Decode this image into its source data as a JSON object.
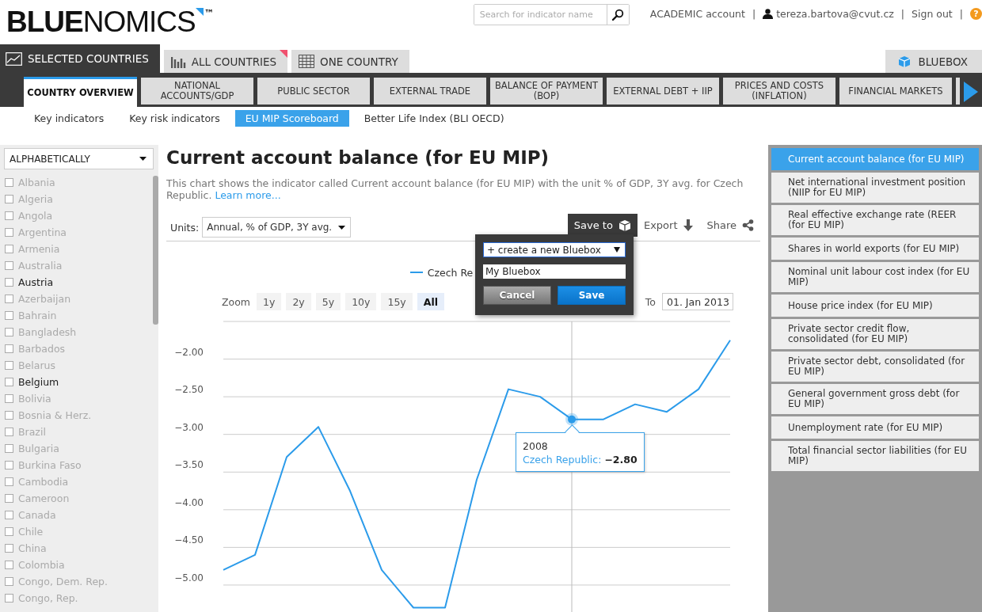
{
  "header": {
    "logo": "**BLUE**NOMICS",
    "trademark": "™",
    "search": {
      "placeholder": "Search for indicator name"
    },
    "account": "ACADEMIC account",
    "user": "tereza.bartova@cvut.cz",
    "sign_out": "Sign out",
    "separators": [
      "|",
      "|",
      "|"
    ],
    "help": "?"
  },
  "top_tabs": [
    {
      "label": "SELECTED COUNTRIES",
      "selected": true,
      "kind": "line",
      "badge": false
    },
    {
      "label": "ALL COUNTRIES",
      "selected": false,
      "kind": "bars",
      "badge": true
    },
    {
      "label": "ONE COUNTRY",
      "selected": false,
      "kind": "grid",
      "badge": false
    }
  ],
  "bluebox_button": "BLUEBOX",
  "category_tabs": [
    {
      "label": "COUNTRY OVERVIEW",
      "selected": true
    },
    {
      "label": "NATIONAL ACCOUNTS/GDP",
      "selected": false
    },
    {
      "label": "PUBLIC SECTOR",
      "selected": false
    },
    {
      "label": "EXTERNAL TRADE",
      "selected": false
    },
    {
      "label": "BALANCE OF PAYMENT (BOP)",
      "selected": false
    },
    {
      "label": "EXTERNAL DEBT + IIP",
      "selected": false
    },
    {
      "label": "PRICES AND COSTS (INFLATION)",
      "selected": false
    },
    {
      "label": "FINANCIAL MARKETS",
      "selected": false
    }
  ],
  "sub_tabs": [
    {
      "label": "Key indicators",
      "selected": false
    },
    {
      "label": "Key risk indicators",
      "selected": false
    },
    {
      "label": "EU MIP Scoreboard",
      "selected": true
    },
    {
      "label": "Better Life Index (BLI OECD)",
      "selected": false
    }
  ],
  "sidebar": {
    "sort": "ALPHABETICALLY",
    "countries": [
      {
        "name": "Albania",
        "disabled": true,
        "checked": false
      },
      {
        "name": "Algeria",
        "disabled": true,
        "checked": false
      },
      {
        "name": "Angola",
        "disabled": true,
        "checked": false
      },
      {
        "name": "Argentina",
        "disabled": true,
        "checked": false
      },
      {
        "name": "Armenia",
        "disabled": true,
        "checked": false
      },
      {
        "name": "Australia",
        "disabled": true,
        "checked": false
      },
      {
        "name": "Austria",
        "disabled": false,
        "checked": false
      },
      {
        "name": "Azerbaijan",
        "disabled": true,
        "checked": false
      },
      {
        "name": "Bahrain",
        "disabled": true,
        "checked": false
      },
      {
        "name": "Bangladesh",
        "disabled": true,
        "checked": false
      },
      {
        "name": "Barbados",
        "disabled": true,
        "checked": false
      },
      {
        "name": "Belarus",
        "disabled": true,
        "checked": false
      },
      {
        "name": "Belgium",
        "disabled": false,
        "checked": false
      },
      {
        "name": "Bolivia",
        "disabled": true,
        "checked": false
      },
      {
        "name": "Bosnia & Herz.",
        "disabled": true,
        "checked": false
      },
      {
        "name": "Brazil",
        "disabled": true,
        "checked": false
      },
      {
        "name": "Bulgaria",
        "disabled": true,
        "checked": false
      },
      {
        "name": "Burkina Faso",
        "disabled": true,
        "checked": false
      },
      {
        "name": "Cambodia",
        "disabled": true,
        "checked": false
      },
      {
        "name": "Cameroon",
        "disabled": true,
        "checked": false
      },
      {
        "name": "Canada",
        "disabled": true,
        "checked": false
      },
      {
        "name": "Chile",
        "disabled": true,
        "checked": false
      },
      {
        "name": "China",
        "disabled": true,
        "checked": false
      },
      {
        "name": "Colombia",
        "disabled": true,
        "checked": false
      },
      {
        "name": "Congo, Dem. Rep.",
        "disabled": true,
        "checked": false
      },
      {
        "name": "Congo, Rep.",
        "disabled": true,
        "checked": false
      }
    ]
  },
  "main": {
    "title": "Current account balance (for EU MIP)",
    "description": "This chart shows the indicator called Current account balance (for EU MIP) with the unit % of GDP, 3Y avg. for Czech Republic.",
    "learn_more": "Learn more...",
    "units_label": "Units:",
    "units_value": "Annual, % of GDP, 3Y avg.",
    "actions": [
      {
        "kind": "save",
        "label": "Save to",
        "selected": true
      },
      {
        "kind": "export",
        "label": "Export",
        "selected": false
      },
      {
        "kind": "share",
        "label": "Share",
        "selected": false
      }
    ],
    "legend": "Czech Re",
    "zoom_label": "Zoom",
    "zoom_buttons": [
      {
        "label": "1y",
        "selected": false
      },
      {
        "label": "2y",
        "selected": false
      },
      {
        "label": "5y",
        "selected": false
      },
      {
        "label": "10y",
        "selected": false
      },
      {
        "label": "15y",
        "selected": false
      },
      {
        "label": "All",
        "selected": true
      }
    ],
    "to_label": "To",
    "to_date": "01. Jan 2013",
    "chart_data": {
      "type": "line",
      "grid": true,
      "series": [
        {
          "color": "#2b9bea",
          "values": [
            -4.8,
            -4.6,
            -3.3,
            -2.9,
            -3.75,
            -4.8,
            -5.3,
            -5.3,
            -3.6,
            -2.4,
            -2.5,
            -2.8,
            -2.8,
            -2.6,
            -2.7,
            -2.4,
            -1.75
          ]
        }
      ],
      "ylim": [
        -5.4,
        -1.5
      ],
      "yticks": [
        {
          "value": -2,
          "label": "−2.00"
        },
        {
          "value": -2.5,
          "label": "−2.50"
        },
        {
          "value": -3,
          "label": "−3.00"
        },
        {
          "value": -3.5,
          "label": "−3.50"
        },
        {
          "value": -4,
          "label": "−4.00"
        },
        {
          "value": -4.5,
          "label": "−4.50"
        },
        {
          "value": -5,
          "label": "−5.00"
        }
      ]
    },
    "tooltip": {
      "title": "2008",
      "series": "Czech Republic:",
      "value": "−2.80"
    },
    "popup": {
      "bluebox_select": "+ create a new Bluebox",
      "name_value": "My Bluebox",
      "cancel": "Cancel",
      "save": "Save"
    }
  },
  "indicators": [
    {
      "label": "Current account balance (for EU MIP)",
      "selected": true
    },
    {
      "label": "Net international investment position (NIIP for EU MIP)",
      "selected": false
    },
    {
      "label": "Real effective exchange rate (REER (for EU MIP)",
      "selected": false
    },
    {
      "label": "Shares in world exports (for EU MIP)",
      "selected": false
    },
    {
      "label": "Nominal unit labour cost index (for EU MIP)",
      "selected": false
    },
    {
      "label": "House price index (for EU MIP)",
      "selected": false
    },
    {
      "label": "Private sector credit flow, consolidated (for EU MIP)",
      "selected": false
    },
    {
      "label": "Private sector debt, consolidated (for EU MIP)",
      "selected": false
    },
    {
      "label": "General government gross debt (for EU MIP)",
      "selected": false
    },
    {
      "label": "Unemployment rate (for EU MIP)",
      "selected": false
    },
    {
      "label": "Total financial sector liabilities (for EU MIP)",
      "selected": false
    }
  ]
}
